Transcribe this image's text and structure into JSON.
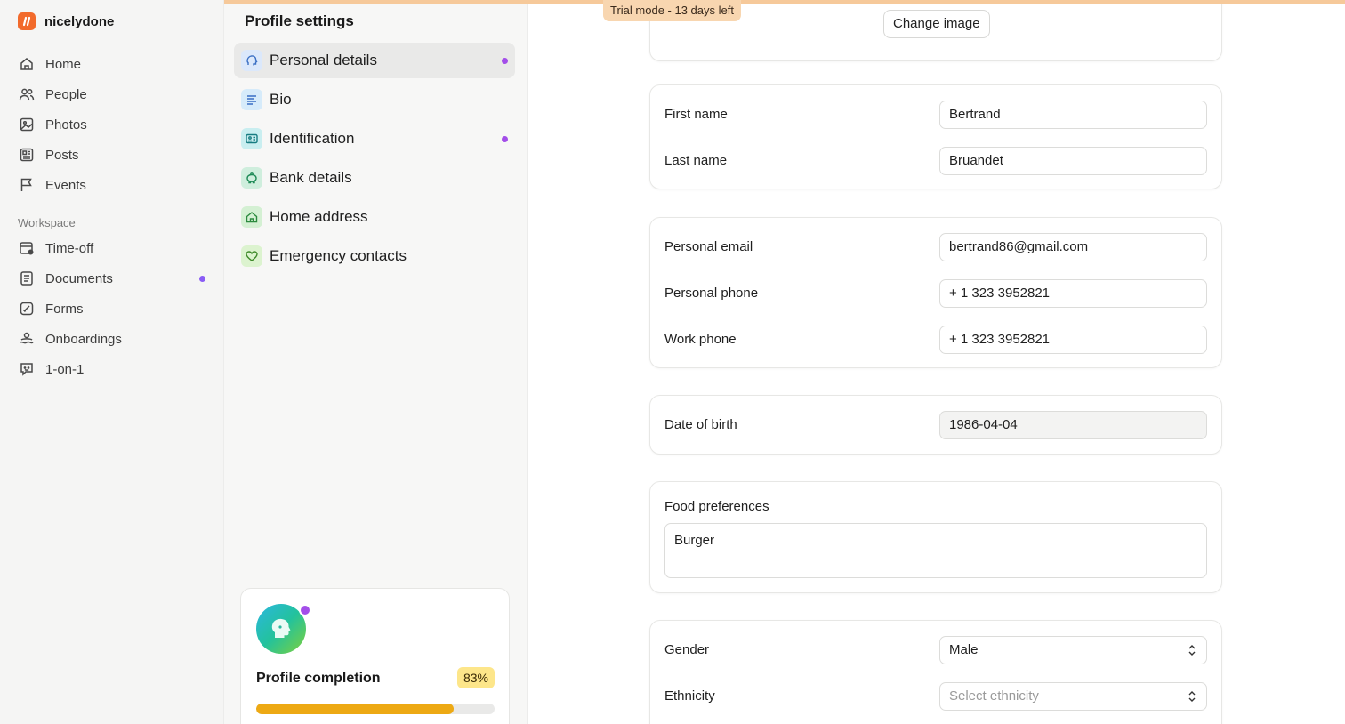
{
  "trial": {
    "text": "Trial mode - 13 days left"
  },
  "app": {
    "name": "nicelydone"
  },
  "nav": {
    "items": [
      {
        "label": "Home",
        "icon": "home-icon"
      },
      {
        "label": "People",
        "icon": "people-icon"
      },
      {
        "label": "Photos",
        "icon": "photos-icon"
      },
      {
        "label": "Posts",
        "icon": "posts-icon"
      },
      {
        "label": "Events",
        "icon": "flag-icon"
      }
    ],
    "workspace_label": "Workspace",
    "workspace_items": [
      {
        "label": "Time-off",
        "icon": "calendar-clock-icon"
      },
      {
        "label": "Documents",
        "icon": "document-icon",
        "has_dot": true
      },
      {
        "label": "Forms",
        "icon": "form-icon"
      },
      {
        "label": "Onboardings",
        "icon": "onboarding-icon"
      },
      {
        "label": "1-on-1",
        "icon": "chat-icon"
      }
    ]
  },
  "profile_settings": {
    "title": "Profile settings",
    "items": [
      {
        "label": "Personal details",
        "icon": "head-icon",
        "active": true,
        "has_dot": true
      },
      {
        "label": "Bio",
        "icon": "text-align-icon"
      },
      {
        "label": "Identification",
        "icon": "id-card-icon",
        "has_dot": true
      },
      {
        "label": "Bank details",
        "icon": "piggy-bank-icon"
      },
      {
        "label": "Home address",
        "icon": "house-icon"
      },
      {
        "label": "Emergency contacts",
        "icon": "heart-icon"
      }
    ],
    "completion": {
      "label": "Profile completion",
      "percent_text": "83%",
      "progress": 0.83
    }
  },
  "form": {
    "change_image_label": "Change image",
    "first_name": {
      "label": "First name",
      "value": "Bertrand"
    },
    "last_name": {
      "label": "Last name",
      "value": "Bruandet"
    },
    "personal_email": {
      "label": "Personal email",
      "value": "bertrand86@gmail.com"
    },
    "personal_phone": {
      "label": "Personal phone",
      "value": "+ 1 323 3952821"
    },
    "work_phone": {
      "label": "Work phone",
      "value": "+ 1 323 3952821"
    },
    "date_of_birth": {
      "label": "Date of birth",
      "value": "1986-04-04"
    },
    "food_preferences": {
      "label": "Food preferences",
      "value": "Burger"
    },
    "gender": {
      "label": "Gender",
      "value": "Male"
    },
    "ethnicity": {
      "label": "Ethnicity",
      "placeholder": "Select ethnicity"
    }
  },
  "colors": {
    "accent_purple": "#a34ee9",
    "brand_orange": "#f26a2b",
    "progress": "#eda914",
    "trial_banner": "#f8d6b0"
  }
}
